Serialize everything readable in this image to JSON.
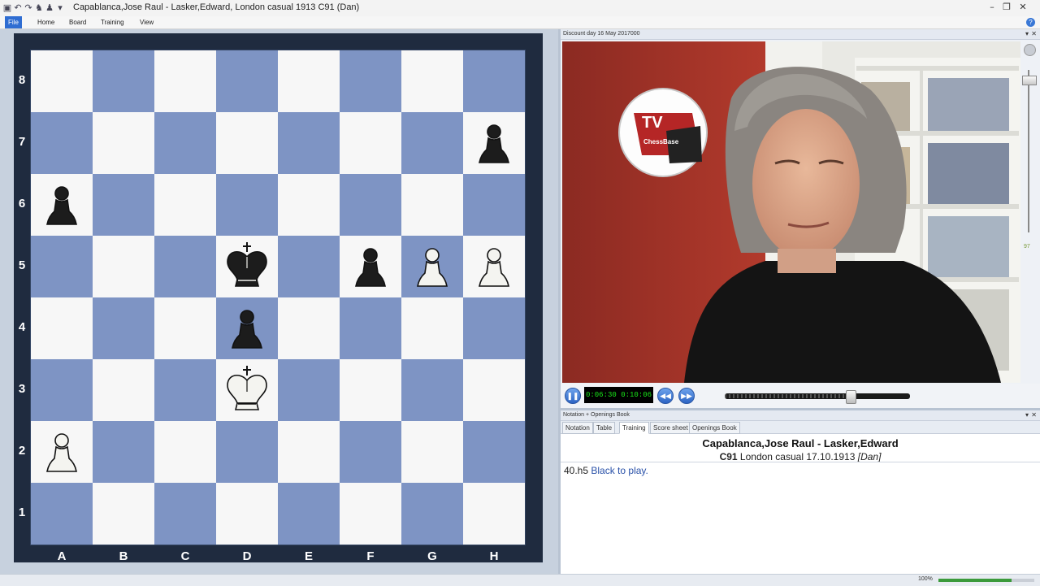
{
  "window": {
    "title": "Capablanca,Jose Raul - Lasker,Edward, London casual 1913  C91  (Dan)",
    "minimize": "–",
    "restore": "❐",
    "close": "✕"
  },
  "quick_access": [
    "▣",
    "↶",
    "↷",
    "♞",
    "♟",
    "▾"
  ],
  "ribbon": {
    "tabs": [
      "File",
      "Home",
      "Board",
      "Training",
      "View"
    ],
    "active": "File",
    "help": "?"
  },
  "board": {
    "ranks": [
      "8",
      "7",
      "6",
      "5",
      "4",
      "3",
      "2",
      "1"
    ],
    "files": [
      "A",
      "B",
      "C",
      "D",
      "E",
      "F",
      "G",
      "H"
    ],
    "pieces": [
      {
        "square": "h7",
        "color": "black",
        "type": "pawn",
        "icon": "black-pawn-icon"
      },
      {
        "square": "a6",
        "color": "black",
        "type": "pawn",
        "icon": "black-pawn-icon"
      },
      {
        "square": "d5",
        "color": "black",
        "type": "king",
        "icon": "black-king-icon"
      },
      {
        "square": "f5",
        "color": "black",
        "type": "pawn",
        "icon": "black-pawn-icon"
      },
      {
        "square": "g5",
        "color": "white",
        "type": "pawn",
        "icon": "white-pawn-icon"
      },
      {
        "square": "h5",
        "color": "white",
        "type": "pawn",
        "icon": "white-pawn-icon"
      },
      {
        "square": "d4",
        "color": "black",
        "type": "pawn",
        "icon": "black-pawn-icon"
      },
      {
        "square": "d3",
        "color": "white",
        "type": "king",
        "icon": "white-king-icon"
      },
      {
        "square": "a2",
        "color": "white",
        "type": "pawn",
        "icon": "white-pawn-icon"
      }
    ],
    "colors": {
      "light": "#f7f7f7",
      "dark": "#7e94c4",
      "frame": "#1f2b3f"
    }
  },
  "video": {
    "header": "Discount day 16 May 2017000",
    "logo_tv": "TV",
    "logo_brand": "ChessBase",
    "side_value": "97",
    "time": "0:06:30 0:10:06",
    "progress": 0.68
  },
  "notation": {
    "header": "Notation + Openings Book",
    "tabs": [
      "Notation",
      "Table",
      "Training",
      "Score sheet",
      "Openings Book"
    ],
    "active_tab": "Training",
    "players": "Capablanca,Jose Raul - Lasker,Edward",
    "eco": "C91",
    "event": "London casual 17.10.1913",
    "annotator": "[Dan]",
    "move": "40.h5",
    "comment": "Black to play."
  },
  "status": {
    "zoom": "100%"
  }
}
